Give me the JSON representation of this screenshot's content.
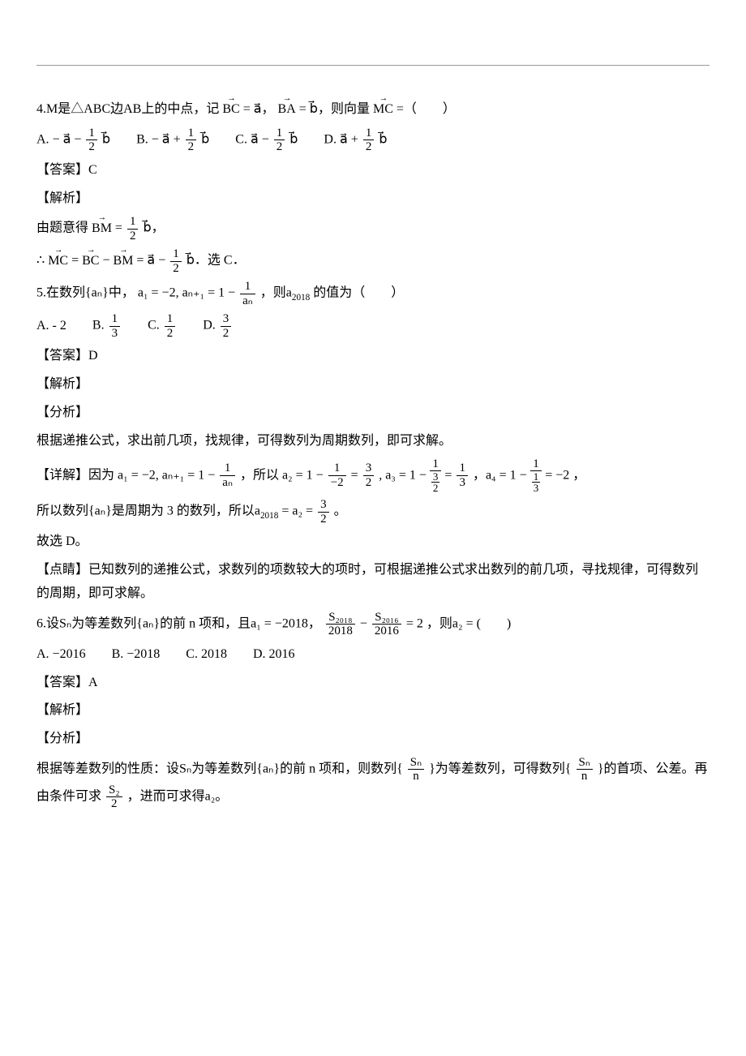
{
  "hr": "",
  "q4": {
    "stem_a": "4.M是△ABC边AB上的中点，记",
    "stem_bc": "BC",
    "stem_eq1": " = a⃗，",
    "stem_ba": "BA",
    "stem_eq2": " = b⃗，则向量",
    "stem_mc": "MC",
    "stem_eq3": " =（　　）",
    "optA_lbl": "A. ",
    "optA_txt": "− a⃗ − ",
    "optA_num": "1",
    "optA_den": "2",
    "optA_tail": "b⃗",
    "optB_lbl": "B. ",
    "optB_txt": "− a⃗ + ",
    "optB_num": "1",
    "optB_den": "2",
    "optB_tail": "b⃗",
    "optC_lbl": "C. ",
    "optC_txt": "a⃗ − ",
    "optC_num": "1",
    "optC_den": "2",
    "optC_tail": "b⃗",
    "optD_lbl": "D. ",
    "optD_txt": "a⃗ + ",
    "optD_num": "1",
    "optD_den": "2",
    "optD_tail": "b⃗",
    "ans": "【答案】C",
    "analysis": "【解析】",
    "line1_a": "由题意得",
    "line1_bm": "BM",
    "line1_eq": " = ",
    "line1_num": "1",
    "line1_den": "2",
    "line1_tail": "b⃗，",
    "line2_a": "∴",
    "line2_mc": "MC",
    "line2_b": " = ",
    "line2_bc": "BC",
    "line2_c": " − ",
    "line2_bm": "BM",
    "line2_d": " = a⃗ − ",
    "line2_num": "1",
    "line2_den": "2",
    "line2_tail": "b⃗．选 C．"
  },
  "q5": {
    "stem_a": "5.在数列{aₙ}中，",
    "stem_b": " a₁ = −2, aₙ₊₁ = 1 − ",
    "stem_num": "1",
    "stem_den": "aₙ",
    "stem_c": "，则a",
    "stem_sub": "2018",
    "stem_d": "的值为（　　）",
    "optA": "A.  - 2",
    "optB_lbl": "B. ",
    "optB_num": "1",
    "optB_den": "3",
    "optC_lbl": "C. ",
    "optC_num": "1",
    "optC_den": "2",
    "optD_lbl": "D. ",
    "optD_num": "3",
    "optD_den": "2",
    "ans": "【答案】D",
    "analysis": "【解析】",
    "fx": "【分析】",
    "fx_text": "根据递推公式，求出前几项，找规律，可得数列为周期数列，即可求解。",
    "detail_a": "【详解】因为",
    "detail_b": "a₁ = −2, aₙ₊₁ = 1 − ",
    "detail_num": "1",
    "detail_den": "aₙ",
    "detail_c": "，所以",
    "a2_lhs": "a₂ = 1 − ",
    "a2_n": "1",
    "a2_d": "−2",
    "a2_eq": " = ",
    "a2_rn": "3",
    "a2_rd": "2",
    "a3_lhs": ", a₃ = 1 − ",
    "a3_n": "1",
    "a3_d_n": "3",
    "a3_d_d": "2",
    "a3_eq": " = ",
    "a3_rn": "1",
    "a3_rd": "3",
    "a4_lhs": "，a₄ = 1 − ",
    "a4_n": "1",
    "a4_d_n": "1",
    "a4_d_d": "3",
    "a4_eq": " = −2",
    "a4_tail": "，",
    "period_a": "所以数列{aₙ}是周期为 3 的数列，所以a",
    "period_sub": "2018",
    "period_b": " = a₂ = ",
    "period_n": "3",
    "period_d": "2",
    "period_c": "。",
    "so": "故选 D。",
    "dj": "【点睛】已知数列的递推公式，求数列的项数较大的项时，可根据递推公式求出数列的前几项，寻找规律，可得数列的周期，即可求解。"
  },
  "q6": {
    "stem_a": "6.设Sₙ为等差数列{aₙ}的前 n 项和，且a₁ = −2018，",
    "f1_n": "S₂₀₁₈",
    "f1_d": "2018",
    "mid": " − ",
    "f2_n": "S₂₀₁₆",
    "f2_d": "2016",
    "stem_b": " = 2 ，则a₂ = (　　)",
    "optA": "A. −2016",
    "optB": "B. −2018",
    "optC": "C. 2018",
    "optD": "D. 2016",
    "ans": "【答案】A",
    "analysis": "【解析】",
    "fx": "【分析】",
    "fx_text_a": "根据等差数列的性质：设Sₙ为等差数列{aₙ}的前 n 项和，则数列{",
    "fx_n1": "Sₙ",
    "fx_d1": "n",
    "fx_text_b": "}为等差数列，可得数列{",
    "fx_n2": "Sₙ",
    "fx_d2": "n",
    "fx_text_c": "}的首项、公差。再由条件可求",
    "fx_n3": "S₂",
    "fx_d3": "2",
    "fx_text_d": "，进而可求得a₂。"
  }
}
